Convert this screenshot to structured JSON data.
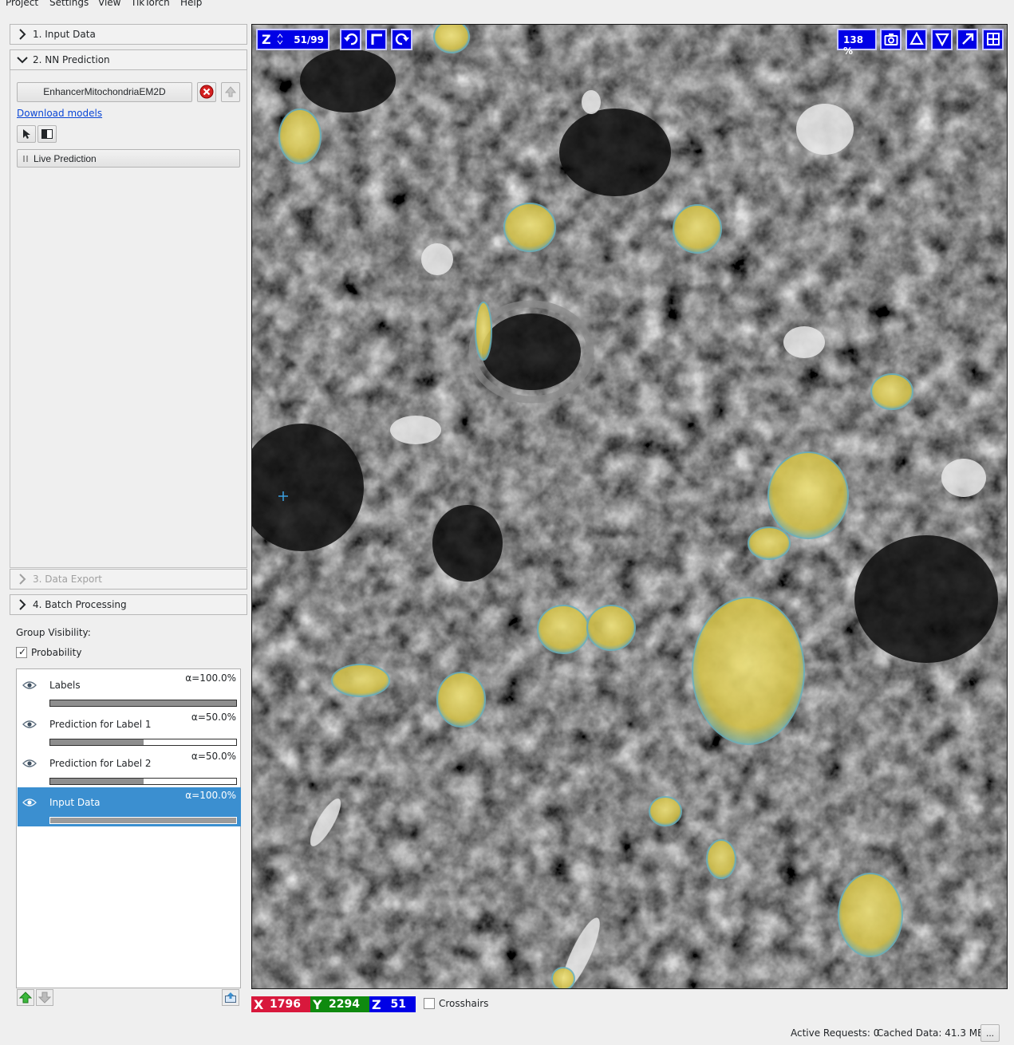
{
  "menu": {
    "items": [
      "Project",
      "Settings",
      "View",
      "TikTorch",
      "Help"
    ]
  },
  "applets": {
    "input_data": "1. Input Data",
    "nn_prediction": "2. NN Prediction",
    "data_export": "3. Data Export",
    "batch_processing": "4. Batch Processing"
  },
  "nn": {
    "model_name": "EnhancerMitochondriaEM2D",
    "download_link": "Download models",
    "live_prediction": "Live Prediction"
  },
  "group_visibility": {
    "label": "Group Visibility:",
    "probability_label": "Probability",
    "probability_checked": "✓"
  },
  "layers": [
    {
      "name": "Labels",
      "alpha": "α=100.0%",
      "opacity": 1.0,
      "selected": false
    },
    {
      "name": "Prediction for Label 1",
      "alpha": "α=50.0%",
      "opacity": 0.5,
      "selected": false
    },
    {
      "name": "Prediction for Label 2",
      "alpha": "α=50.0%",
      "opacity": 0.5,
      "selected": false
    },
    {
      "name": "Input Data",
      "alpha": "α=100.0%",
      "opacity": 1.0,
      "selected": true
    }
  ],
  "viewer": {
    "axis_label": "Z",
    "slice_position": "51/99",
    "zoom": "138 %"
  },
  "coords": {
    "x_label": "X",
    "x_value": "1796",
    "y_label": "Y",
    "y_value": "2294",
    "z_label": "Z",
    "z_value": "51",
    "crosshairs_label": "Crosshairs"
  },
  "status": {
    "active_requests": "Active Requests: 0",
    "cached_data": "Cached Data: 41.3 MB",
    "more_button": "..."
  },
  "colors": {
    "accent": "#3b8fd0",
    "viewer_button": "#0000e6",
    "coord_x": "#d8183c",
    "coord_y": "#0f8a0f",
    "coord_z": "#0000e6",
    "prediction_overlay": "#e6d24a"
  }
}
